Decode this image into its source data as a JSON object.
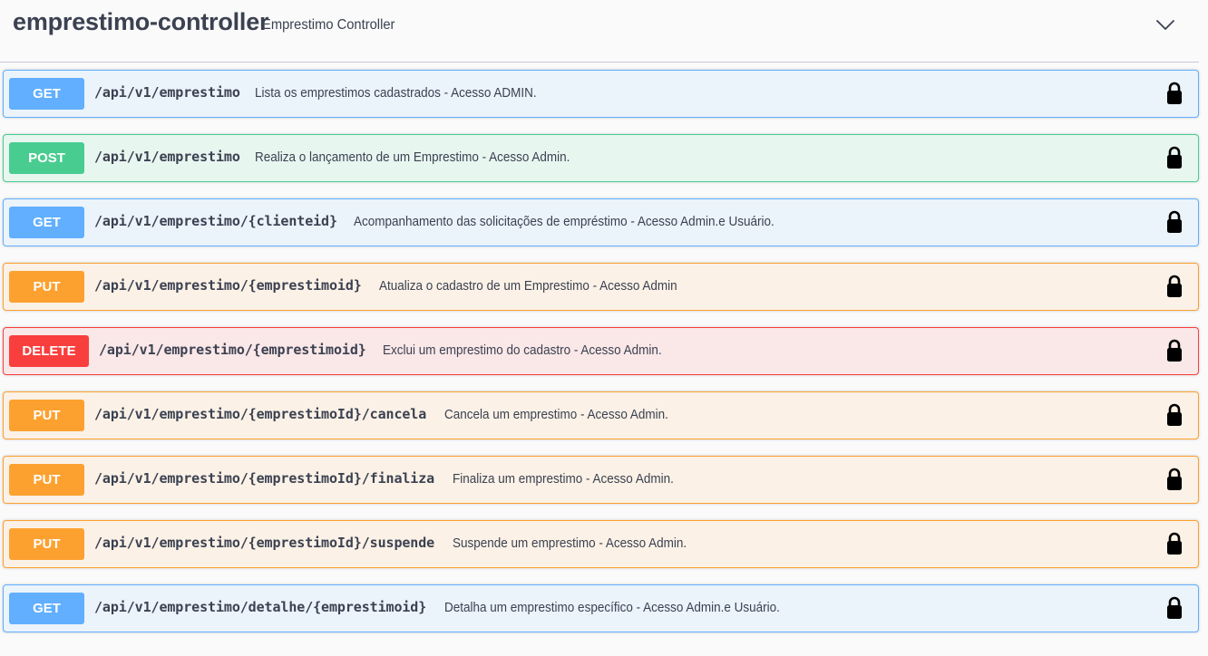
{
  "tag": {
    "name": "emprestimo-controller",
    "description": "Emprestimo Controller"
  },
  "operations": [
    {
      "method": "GET",
      "path": "/api/v1/emprestimo",
      "summary": "Lista os emprestimos cadastrados - Acesso ADMIN."
    },
    {
      "method": "POST",
      "path": "/api/v1/emprestimo",
      "summary": "Realiza o lançamento de um Emprestimo - Acesso Admin."
    },
    {
      "method": "GET",
      "path": "/api/v1/emprestimo/{clienteid}",
      "summary": "Acompanhamento das solicitações de empréstimo - Acesso Admin.e Usuário."
    },
    {
      "method": "PUT",
      "path": "/api/v1/emprestimo/{emprestimoid}",
      "summary": "Atualiza o cadastro de um Emprestimo - Acesso Admin"
    },
    {
      "method": "DELETE",
      "path": "/api/v1/emprestimo/{emprestimoid}",
      "summary": "Exclui um emprestimo do cadastro - Acesso Admin."
    },
    {
      "method": "PUT",
      "path": "/api/v1/emprestimo/{emprestimoId}/cancela",
      "summary": "Cancela um emprestimo - Acesso Admin."
    },
    {
      "method": "PUT",
      "path": "/api/v1/emprestimo/{emprestimoId}/finaliza",
      "summary": "Finaliza um emprestimo - Acesso Admin."
    },
    {
      "method": "PUT",
      "path": "/api/v1/emprestimo/{emprestimoId}/suspende",
      "summary": "Suspende um emprestimo - Acesso Admin."
    },
    {
      "method": "GET",
      "path": "/api/v1/emprestimo/detalhe/{emprestimoid}",
      "summary": "Detalha um emprestimo específico - Acesso Admin.e Usuário."
    }
  ],
  "icons": {
    "chevron": "chevron-down-icon",
    "lock": "lock-icon"
  },
  "colors": {
    "get": "#61affe",
    "post": "#49cc90",
    "put": "#fca130",
    "delete": "#f93e3e",
    "text": "#3b4151"
  }
}
